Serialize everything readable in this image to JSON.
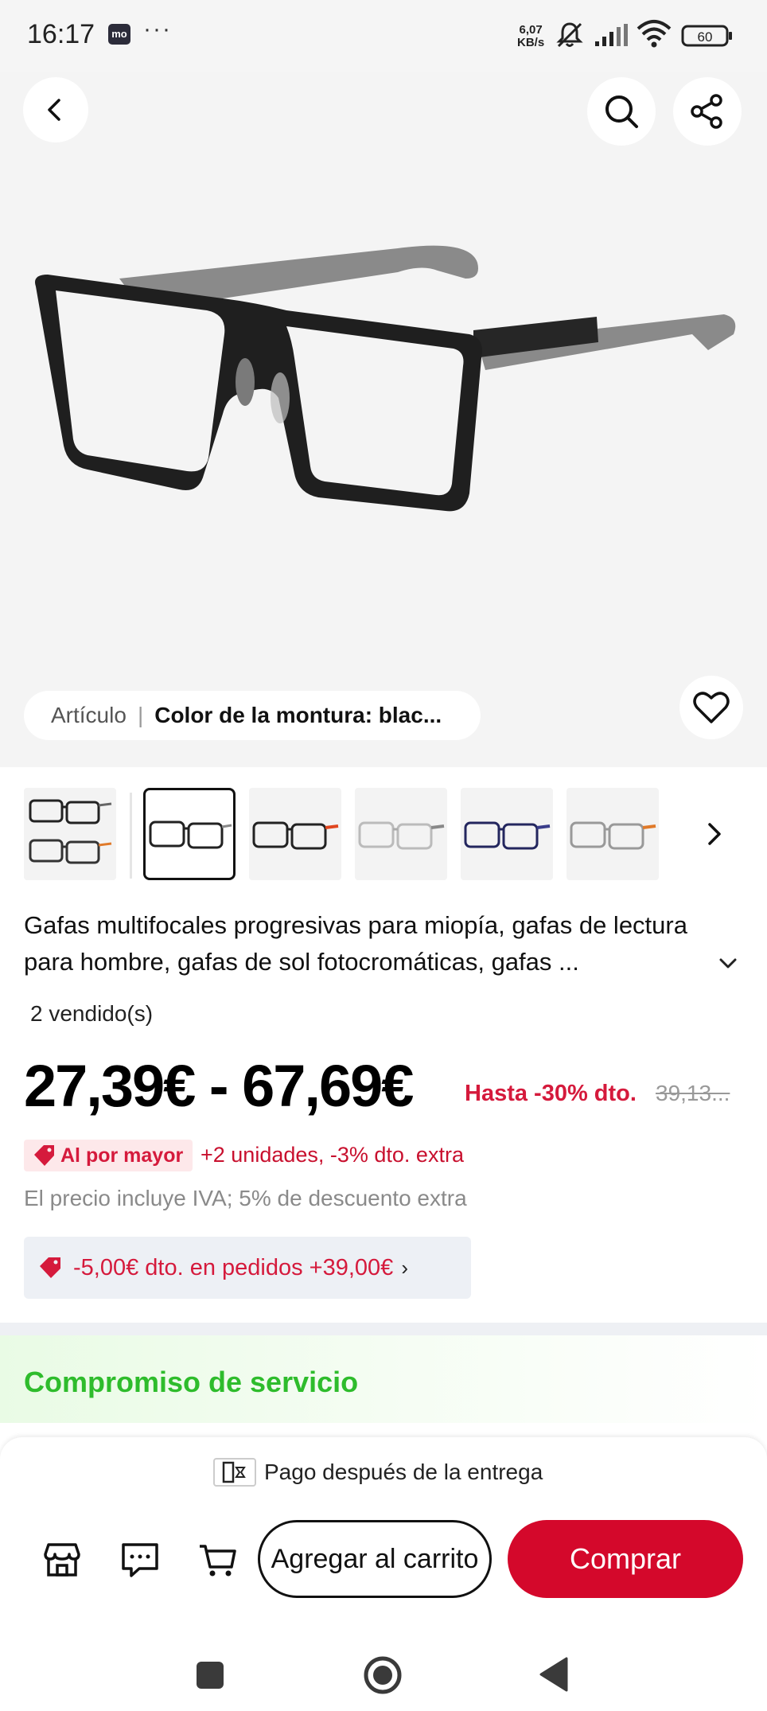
{
  "status_bar": {
    "time": "16:17",
    "app_icon_text": "mo",
    "dots": "···",
    "speed_value": "6,07",
    "speed_unit": "KB/s",
    "battery": "60"
  },
  "hero": {
    "caption_label": "Artículo",
    "caption_separator": "|",
    "caption_value": "Color de la montura: blac..."
  },
  "thumbnails": [
    {
      "name": "combo-black-orange",
      "selected": false
    },
    {
      "name": "black-gray",
      "selected": true
    },
    {
      "name": "black-orange",
      "selected": false
    },
    {
      "name": "clear-gray",
      "selected": false
    },
    {
      "name": "navy-blue",
      "selected": false
    },
    {
      "name": "clear-orange",
      "selected": false
    }
  ],
  "product": {
    "title": "Gafas multifocales progresivas para miopía, gafas de lectura para hombre, gafas de sol fotocromáticas, gafas ...",
    "sold": "2 vendido(s)",
    "price_range": "27,39€ - 67,69€",
    "discount": "Hasta -30% dto.",
    "original_price": "39,13..."
  },
  "wholesale": {
    "badge": "Al por mayor",
    "text": "+2 unidades, -3% dto. extra"
  },
  "vat_text": "El precio incluye IVA; 5% de descuento extra",
  "coupon": {
    "text": "-5,00€ dto. en pedidos +39,00€",
    "chevron": "›"
  },
  "service": {
    "title": "Compromiso de servicio"
  },
  "bottom_bar": {
    "pay_after_delivery": "Pago después de la entrega",
    "add_to_cart": "Agregar al carrito",
    "buy": "Comprar"
  },
  "colors": {
    "accent_red": "#d4082b",
    "discount_red": "#d51a3c",
    "service_green": "#2ebc2c",
    "hero_background": "#f4f4f4"
  },
  "icons": [
    "back-icon",
    "search-icon",
    "share-icon",
    "heart-icon",
    "chevron-right-icon",
    "chevron-down-icon",
    "store-icon",
    "chat-icon",
    "cart-icon",
    "tag-icon",
    "recent-apps-icon",
    "home-icon",
    "back-nav-icon"
  ]
}
